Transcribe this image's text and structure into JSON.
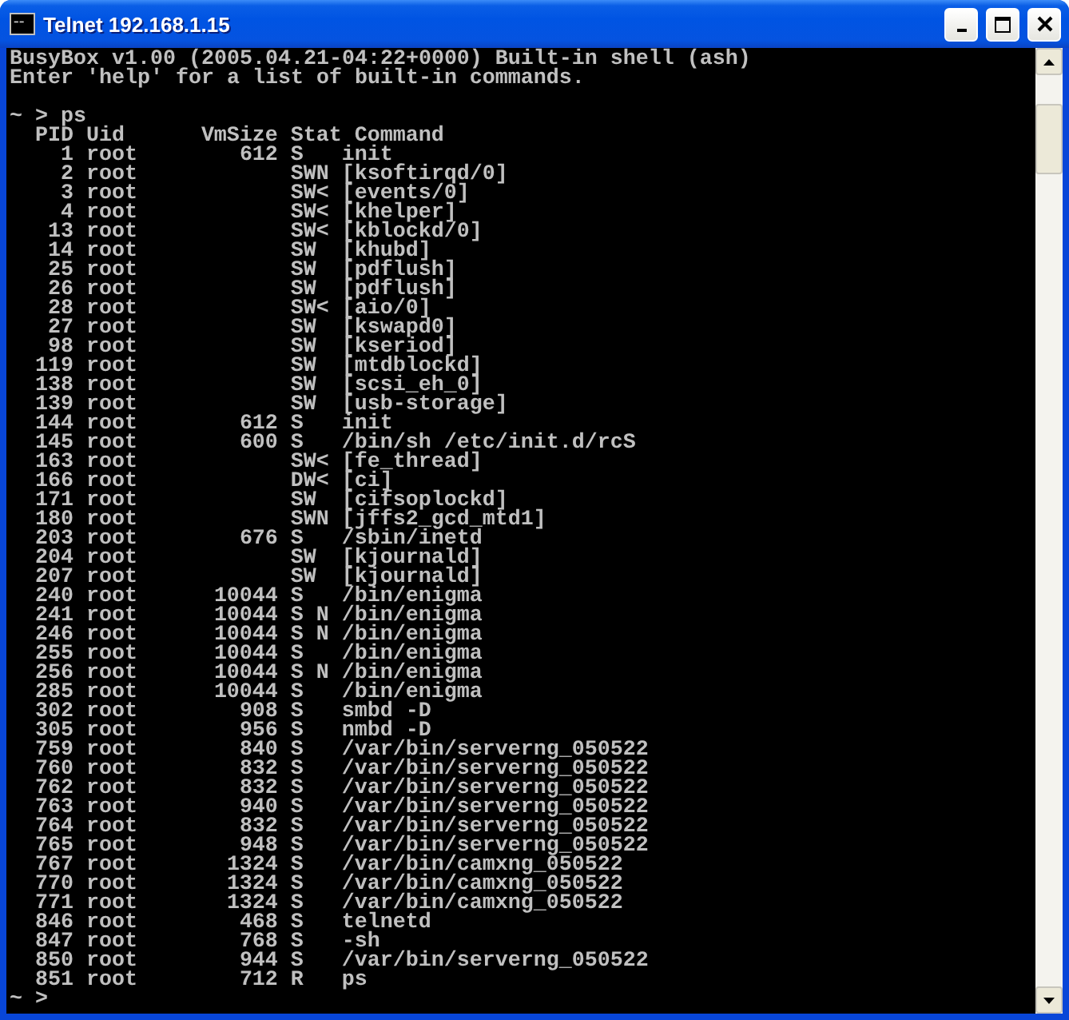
{
  "window": {
    "title": "Telnet 192.168.1.15"
  },
  "console": {
    "intro": [
      "BusyBox v1.00 (2005.04.21-04:22+0000) Built-in shell (ash)",
      "Enter 'help' for a list of built-in commands."
    ],
    "command_line": "~ > ps",
    "columns": [
      "PID",
      "Uid",
      "VmSize",
      "Stat",
      "Command"
    ],
    "rows": [
      {
        "pid": "1",
        "uid": "root",
        "vmsize": "612",
        "stat": "S",
        "command": "init"
      },
      {
        "pid": "2",
        "uid": "root",
        "stat": "SWN",
        "command": "[ksoftirqd/0]"
      },
      {
        "pid": "3",
        "uid": "root",
        "stat": "SW<",
        "command": "[events/0]"
      },
      {
        "pid": "4",
        "uid": "root",
        "stat": "SW<",
        "command": "[khelper]"
      },
      {
        "pid": "13",
        "uid": "root",
        "stat": "SW<",
        "command": "[kblockd/0]"
      },
      {
        "pid": "14",
        "uid": "root",
        "stat": "SW",
        "command": "[khubd]"
      },
      {
        "pid": "25",
        "uid": "root",
        "stat": "SW",
        "command": "[pdflush]"
      },
      {
        "pid": "26",
        "uid": "root",
        "stat": "SW",
        "command": "[pdflush]"
      },
      {
        "pid": "28",
        "uid": "root",
        "stat": "SW<",
        "command": "[aio/0]"
      },
      {
        "pid": "27",
        "uid": "root",
        "stat": "SW",
        "command": "[kswapd0]"
      },
      {
        "pid": "98",
        "uid": "root",
        "stat": "SW",
        "command": "[kseriod]"
      },
      {
        "pid": "119",
        "uid": "root",
        "stat": "SW",
        "command": "[mtdblockd]"
      },
      {
        "pid": "138",
        "uid": "root",
        "stat": "SW",
        "command": "[scsi_eh_0]"
      },
      {
        "pid": "139",
        "uid": "root",
        "stat": "SW",
        "command": "[usb-storage]"
      },
      {
        "pid": "144",
        "uid": "root",
        "vmsize": "612",
        "stat": "S",
        "command": "init"
      },
      {
        "pid": "145",
        "uid": "root",
        "vmsize": "600",
        "stat": "S",
        "command": "/bin/sh /etc/init.d/rcS"
      },
      {
        "pid": "163",
        "uid": "root",
        "stat": "SW<",
        "command": "[fe_thread]"
      },
      {
        "pid": "166",
        "uid": "root",
        "stat": "DW<",
        "command": "[ci]"
      },
      {
        "pid": "171",
        "uid": "root",
        "stat": "SW",
        "command": "[cifsoplockd]"
      },
      {
        "pid": "180",
        "uid": "root",
        "stat": "SWN",
        "command": "[jffs2_gcd_mtd1]"
      },
      {
        "pid": "203",
        "uid": "root",
        "vmsize": "676",
        "stat": "S",
        "command": "/sbin/inetd"
      },
      {
        "pid": "204",
        "uid": "root",
        "stat": "SW",
        "command": "[kjournald]"
      },
      {
        "pid": "207",
        "uid": "root",
        "stat": "SW",
        "command": "[kjournald]"
      },
      {
        "pid": "240",
        "uid": "root",
        "vmsize": "10044",
        "stat": "S",
        "command": "/bin/enigma"
      },
      {
        "pid": "241",
        "uid": "root",
        "vmsize": "10044",
        "stat": "S N",
        "command": "/bin/enigma"
      },
      {
        "pid": "246",
        "uid": "root",
        "vmsize": "10044",
        "stat": "S N",
        "command": "/bin/enigma"
      },
      {
        "pid": "255",
        "uid": "root",
        "vmsize": "10044",
        "stat": "S",
        "command": "/bin/enigma"
      },
      {
        "pid": "256",
        "uid": "root",
        "vmsize": "10044",
        "stat": "S N",
        "command": "/bin/enigma"
      },
      {
        "pid": "285",
        "uid": "root",
        "vmsize": "10044",
        "stat": "S",
        "command": "/bin/enigma"
      },
      {
        "pid": "302",
        "uid": "root",
        "vmsize": "908",
        "stat": "S",
        "command": "smbd -D"
      },
      {
        "pid": "305",
        "uid": "root",
        "vmsize": "956",
        "stat": "S",
        "command": "nmbd -D"
      },
      {
        "pid": "759",
        "uid": "root",
        "vmsize": "840",
        "stat": "S",
        "command": "/var/bin/serverng_050522"
      },
      {
        "pid": "760",
        "uid": "root",
        "vmsize": "832",
        "stat": "S",
        "command": "/var/bin/serverng_050522"
      },
      {
        "pid": "762",
        "uid": "root",
        "vmsize": "832",
        "stat": "S",
        "command": "/var/bin/serverng_050522"
      },
      {
        "pid": "763",
        "uid": "root",
        "vmsize": "940",
        "stat": "S",
        "command": "/var/bin/serverng_050522"
      },
      {
        "pid": "764",
        "uid": "root",
        "vmsize": "832",
        "stat": "S",
        "command": "/var/bin/serverng_050522"
      },
      {
        "pid": "765",
        "uid": "root",
        "vmsize": "948",
        "stat": "S",
        "command": "/var/bin/serverng_050522"
      },
      {
        "pid": "767",
        "uid": "root",
        "vmsize": "1324",
        "stat": "S",
        "command": "/var/bin/camxng_050522"
      },
      {
        "pid": "770",
        "uid": "root",
        "vmsize": "1324",
        "stat": "S",
        "command": "/var/bin/camxng_050522"
      },
      {
        "pid": "771",
        "uid": "root",
        "vmsize": "1324",
        "stat": "S",
        "command": "/var/bin/camxng_050522"
      },
      {
        "pid": "846",
        "uid": "root",
        "vmsize": "468",
        "stat": "S",
        "command": "telnetd"
      },
      {
        "pid": "847",
        "uid": "root",
        "vmsize": "768",
        "stat": "S",
        "command": "-sh"
      },
      {
        "pid": "850",
        "uid": "root",
        "vmsize": "944",
        "stat": "S",
        "command": "/var/bin/serverng_050522"
      },
      {
        "pid": "851",
        "uid": "root",
        "vmsize": "712",
        "stat": "R",
        "command": "ps"
      }
    ],
    "prompt": "~ >"
  }
}
